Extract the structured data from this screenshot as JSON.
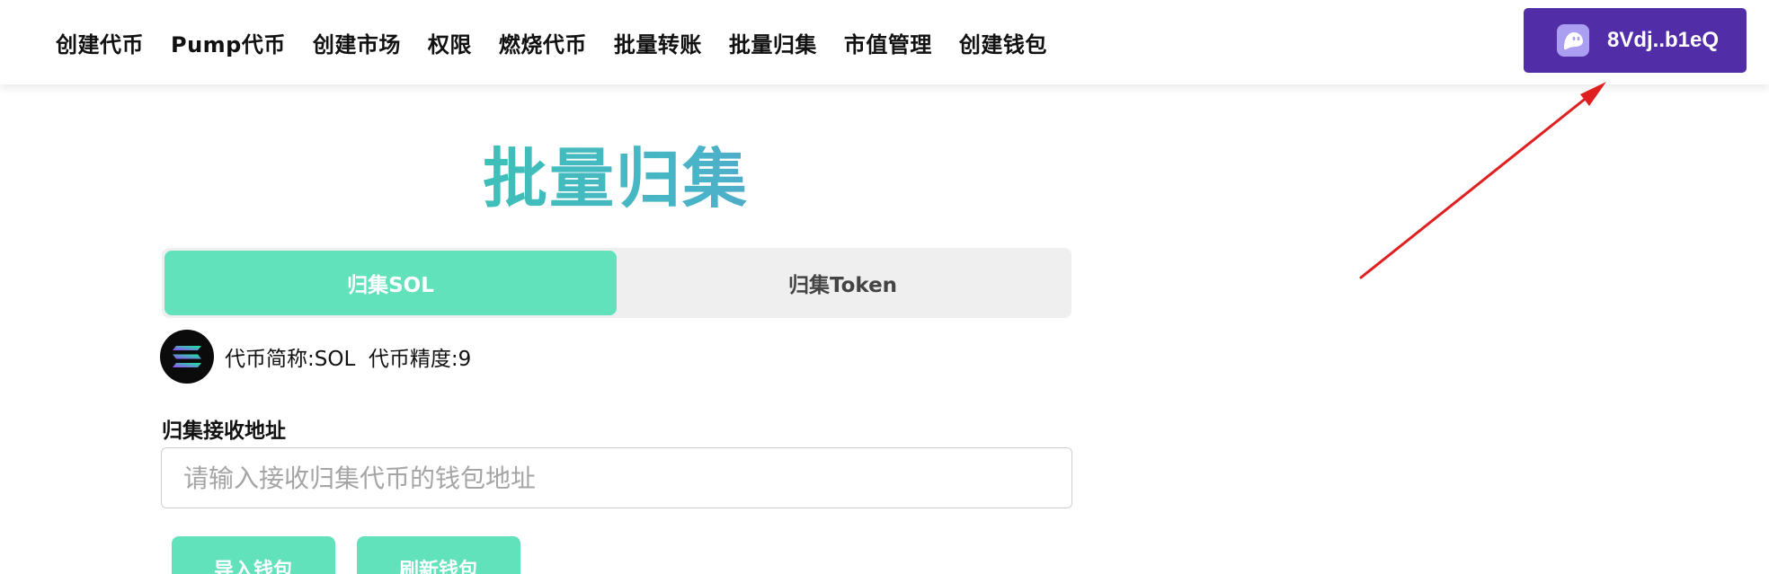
{
  "nav": {
    "items": [
      {
        "label": "创建代币"
      },
      {
        "label": "Pump代币"
      },
      {
        "label": "创建市场"
      },
      {
        "label": "权限"
      },
      {
        "label": "燃烧代币"
      },
      {
        "label": "批量转账"
      },
      {
        "label": "批量归集"
      },
      {
        "label": "市值管理"
      },
      {
        "label": "创建钱包"
      }
    ]
  },
  "wallet": {
    "address": "8Vdj..b1eQ",
    "icon": "phantom-ghost-icon",
    "color": "#512da8"
  },
  "page": {
    "title": "批量归集"
  },
  "tabs": [
    {
      "label": "归集SOL",
      "active": true
    },
    {
      "label": "归集Token",
      "active": false
    }
  ],
  "token": {
    "icon": "solana-logo-icon",
    "info": "代币简称:SOL  代币精度:9"
  },
  "form": {
    "receive_label": "归集接收地址",
    "receive_placeholder": "请输入接收归集代币的钱包地址",
    "import_button": "导入钱包",
    "refresh_button": "刷新钱包"
  },
  "colors": {
    "accent": "#62e2bb",
    "wallet": "#512da8",
    "annotation_arrow": "#e02020"
  }
}
